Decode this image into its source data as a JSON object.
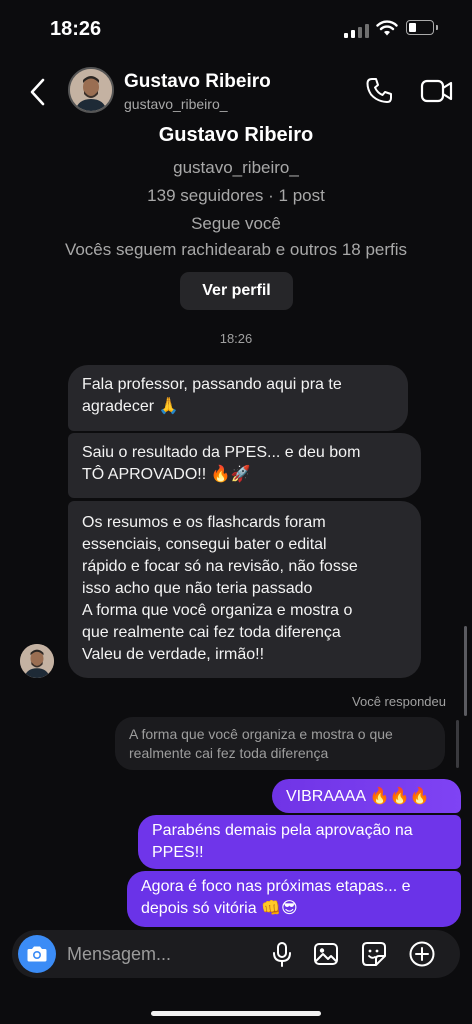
{
  "status": {
    "time": "18:26"
  },
  "header": {
    "name": "Gustavo Ribeiro",
    "username": "gustavo_ribeiro_"
  },
  "profile": {
    "name": "Gustavo Ribeiro",
    "username": "gustavo_ribeiro_",
    "stats": "139 seguidores · 1 post",
    "follows_you": "Segue você",
    "mutual": "Vocês seguem rachidearab e outros 18 perfis",
    "view_button": "Ver perfil"
  },
  "timestamp": "18:26",
  "incoming": [
    {
      "lines": [
        "Fala professor, passando aqui pra te",
        "agradecer 🙏"
      ]
    },
    {
      "lines": [
        "Saiu o resultado da PPES... e deu bom",
        "TÔ APROVADO!! 🔥🚀"
      ]
    },
    {
      "lines": [
        "Os resumos e os flashcards foram",
        "essenciais, consegui bater o edital",
        "rápido e focar só na revisão, não fosse",
        "isso acho que não teria passado",
        "A forma que você organiza e mostra o",
        "que realmente cai fez toda diferença",
        "Valeu de verdade, irmão!!"
      ]
    }
  ],
  "reply_context": {
    "label": "Você respondeu",
    "quote_lines": [
      "A forma que você organiza e mostra o que",
      "realmente cai fez toda diferença"
    ]
  },
  "outgoing": [
    {
      "lines": [
        "VIBRAAAA 🔥🔥🔥"
      ]
    },
    {
      "lines": [
        "Parabéns demais pela aprovação na",
        "PPES!!"
      ]
    },
    {
      "lines": [
        "Agora é foco nas próximas etapas... e",
        "depois só vitória 👊😎"
      ]
    }
  ],
  "composer": {
    "placeholder": "Mensagem..."
  },
  "colors": {
    "outgoing_bubble": "#7b3ff2",
    "incoming_bubble": "#27272b",
    "camera_button": "#3b8cf6",
    "background": "#0c0c0e"
  },
  "icons": [
    "back-chevron-icon",
    "phone-icon",
    "video-camera-icon",
    "camera-icon",
    "microphone-icon",
    "gallery-icon",
    "sticker-icon",
    "plus-icon"
  ]
}
